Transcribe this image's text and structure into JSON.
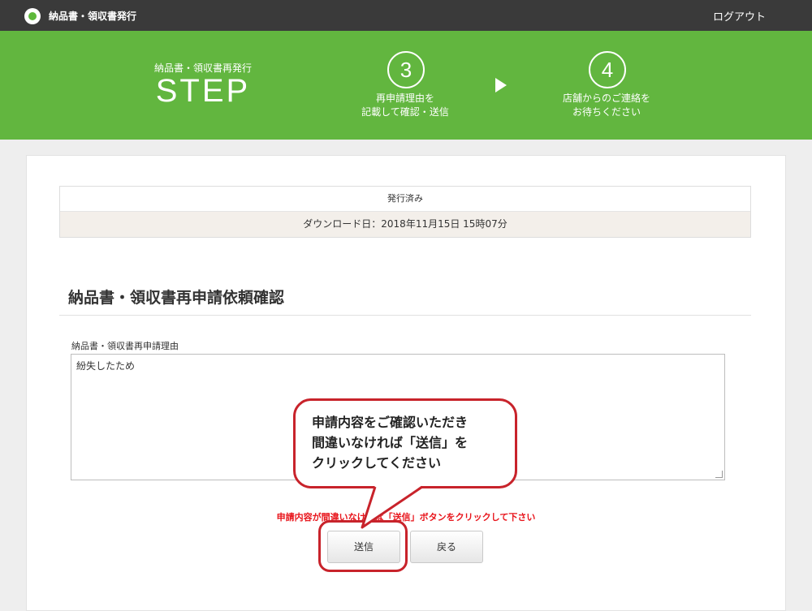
{
  "header": {
    "app_title": "納品書・領収書発行",
    "logout_label": "ログアウト"
  },
  "steps": {
    "subtitle": "納品書・領収書再発行",
    "label": "STEP",
    "step3": {
      "number": "3",
      "line1": "再申請理由を",
      "line2": "記載して確認・送信"
    },
    "step4": {
      "number": "4",
      "line1": "店舗からのご連絡を",
      "line2": "お待ちください"
    }
  },
  "status": {
    "state": "発行済み",
    "download_date": "ダウンロード日：2018年11月15日 15時07分"
  },
  "form": {
    "title": "納品書・領収書再申請依頼確認",
    "reason_label": "納品書・領収書再申請理由",
    "reason_value": "紛失したため",
    "notice": "申請内容が間違いなければ「送信」ボタンをクリックして下さい",
    "submit_label": "送信",
    "back_label": "戻る"
  },
  "callout": {
    "line1": "申請内容をご確認いただき",
    "line2": "間違いなければ「送信」を",
    "line3": "クリックしてください"
  },
  "colors": {
    "banner": "#62b63f",
    "topbar": "#3a3a3a",
    "notice": "#e8141b",
    "highlight": "#c8232b"
  }
}
